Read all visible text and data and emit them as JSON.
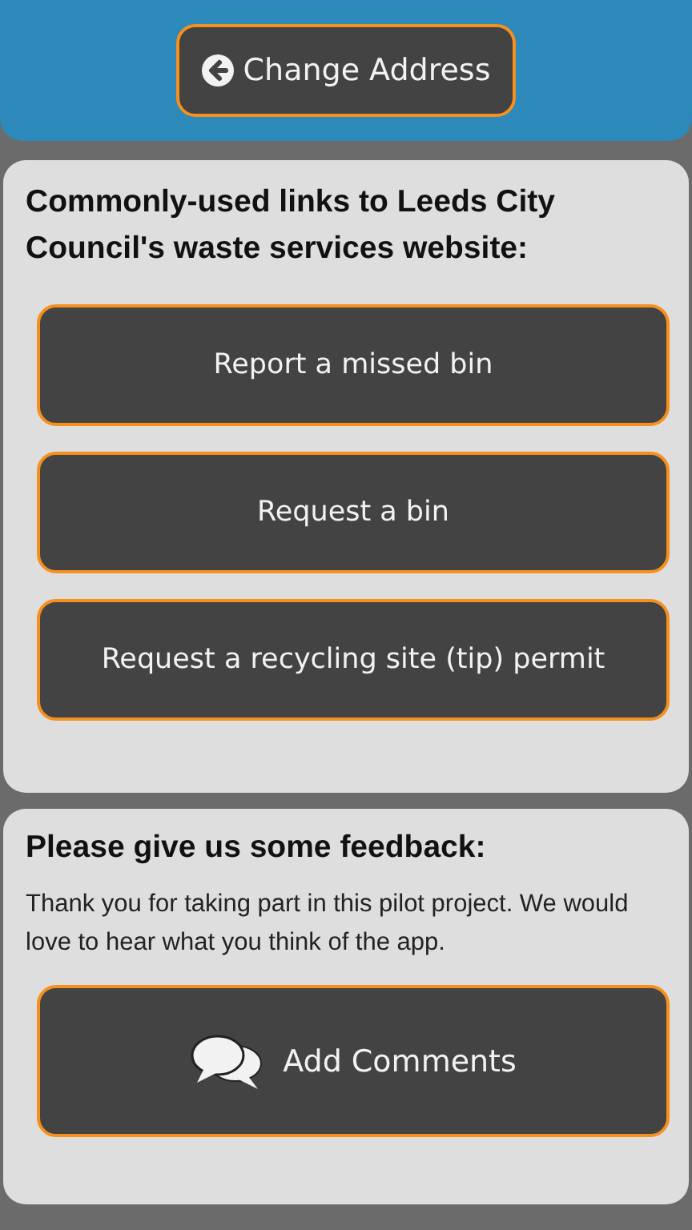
{
  "header": {
    "button": "Change Address"
  },
  "links": {
    "title": "Commonly-used links to Leeds City Council's waste services website:",
    "buttons": [
      "Report a missed bin",
      "Request a bin",
      "Request a recycling site (tip) permit"
    ]
  },
  "feedback": {
    "title": "Please give us some feedback:",
    "text": "Thank you for taking part in this pilot project. We would love to hear what you think of the app.",
    "button": "Add Comments"
  }
}
